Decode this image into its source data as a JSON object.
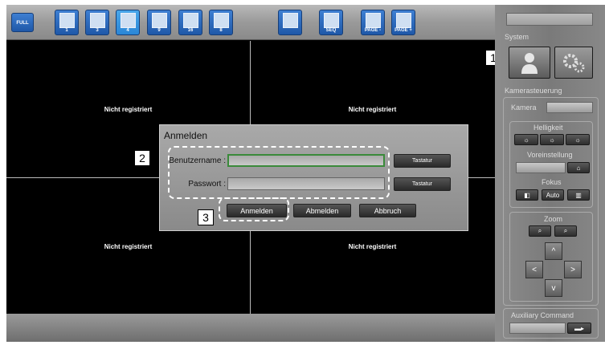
{
  "toolbar": {
    "buttons": [
      {
        "label": "FULL",
        "icon": "full-screen-icon"
      },
      {
        "label": "1",
        "icon": "layout-1-icon"
      },
      {
        "label": "3",
        "icon": "layout-3-icon"
      },
      {
        "label": "4",
        "icon": "layout-4-icon",
        "active": true
      },
      {
        "label": "9",
        "icon": "layout-9-icon"
      },
      {
        "label": "16",
        "icon": "layout-16-icon"
      },
      {
        "label": "8",
        "icon": "layout-8-icon"
      },
      {
        "label": "",
        "icon": "camera-info-icon"
      },
      {
        "label": "SEQ",
        "icon": "sequence-icon"
      },
      {
        "label": "PAGE -",
        "icon": "page-prev-icon"
      },
      {
        "label": "PAGE +",
        "icon": "page-next-icon"
      }
    ]
  },
  "cells": [
    "Nicht registriert",
    "Nicht registriert",
    "Nicht registriert",
    "Nicht registriert"
  ],
  "dialog": {
    "title": "Anmelden",
    "username_label": "Benutzername :",
    "username_value": "",
    "password_label": "Passwort :",
    "password_value": "",
    "keyboard_label": "Tastatur",
    "login": "Anmelden",
    "logout": "Abmelden",
    "cancel": "Abbruch"
  },
  "callouts": [
    "1",
    "2",
    "3"
  ],
  "panel": {
    "system": "System",
    "camera_control": "Kamerasteuerung",
    "camera_label": "Kamera",
    "brightness": "Helligkeit",
    "preset": "Voreinstellung",
    "focus": "Fokus",
    "focus_auto": "Auto",
    "zoom": "Zoom",
    "up": "^",
    "down": "v",
    "left": "<",
    "right": ">",
    "auxiliary": "Auxiliary Command"
  },
  "colors": {
    "accent_blue": "#2a86d6",
    "focus_green": "#3a8a3a"
  }
}
